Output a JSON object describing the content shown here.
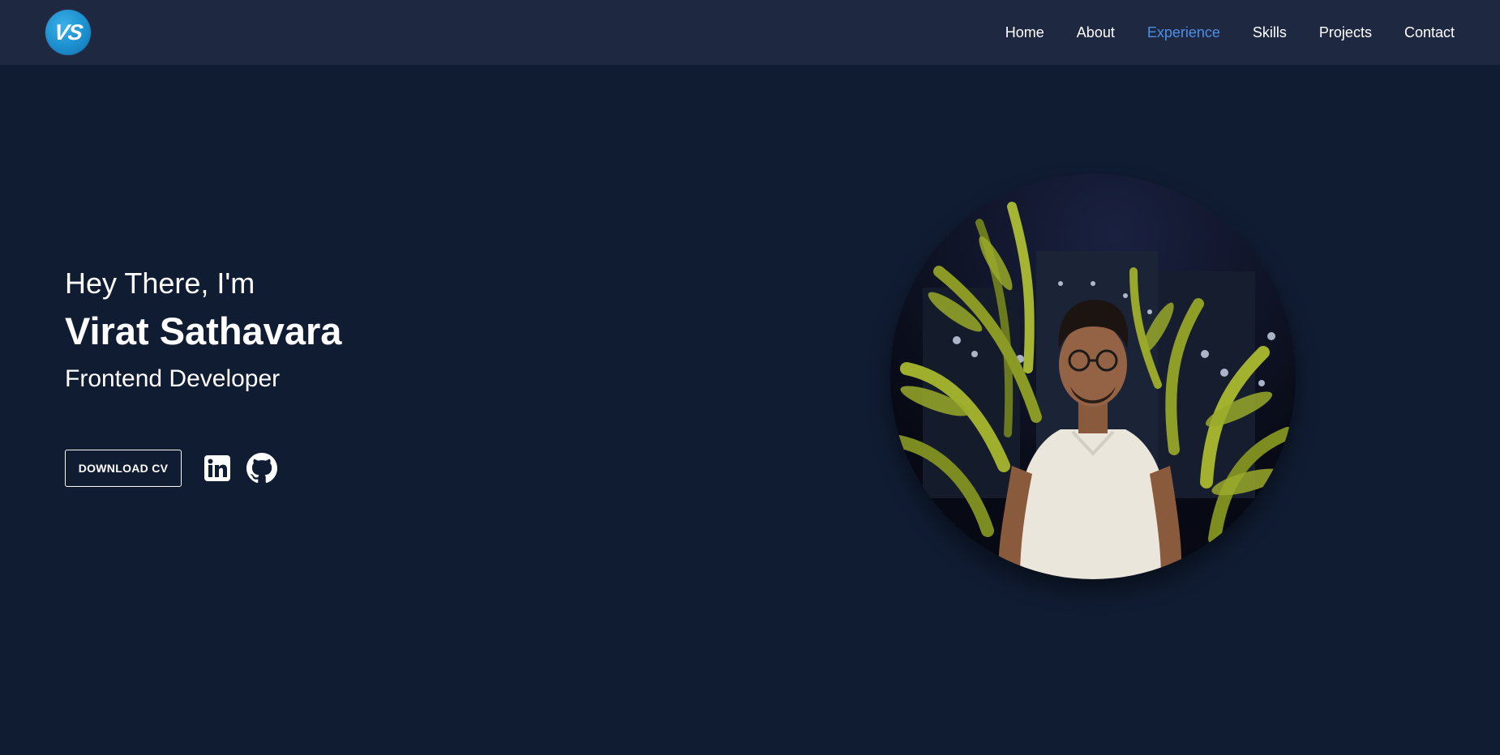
{
  "nav": {
    "logo_text": "VS",
    "links": [
      {
        "label": "Home",
        "active": false
      },
      {
        "label": "About",
        "active": false
      },
      {
        "label": "Experience",
        "active": true
      },
      {
        "label": "Skills",
        "active": false
      },
      {
        "label": "Projects",
        "active": false
      },
      {
        "label": "Contact",
        "active": false
      }
    ]
  },
  "hero": {
    "greeting": "Hey There, I'm",
    "name": "Virat Sathavara",
    "role": "Frontend Developer",
    "cv_button": "DOWNLOAD CV",
    "social_icons": [
      "linkedin-icon",
      "github-icon"
    ]
  },
  "colors": {
    "page_bg": "#101c32",
    "nav_bg": "#1e2841",
    "accent": "#4e8fe6",
    "logo": "#1c8fcf"
  }
}
